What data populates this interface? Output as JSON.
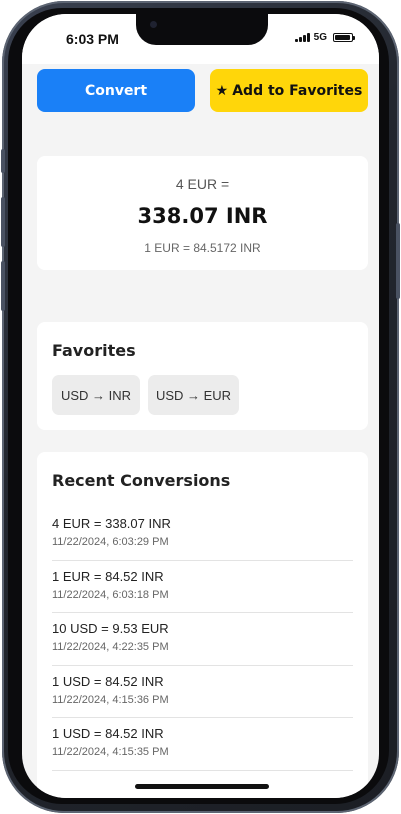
{
  "status_bar": {
    "time": "6:03 PM",
    "network": "5G"
  },
  "actions": {
    "convert_label": "Convert",
    "favorite_icon": "★",
    "favorite_label": "Add to Favorites"
  },
  "result": {
    "input": "4 EUR =",
    "output": "338.07 INR",
    "rate": "1 EUR = 84.5172 INR"
  },
  "favorites": {
    "title": "Favorites",
    "items": [
      {
        "label": "USD → INR"
      },
      {
        "label": "USD → EUR"
      }
    ]
  },
  "recent": {
    "title": "Recent Conversions",
    "items": [
      {
        "conversion": "4 EUR = 338.07 INR",
        "timestamp": "11/22/2024, 6:03:29 PM"
      },
      {
        "conversion": "1 EUR = 84.52 INR",
        "timestamp": "11/22/2024, 6:03:18 PM"
      },
      {
        "conversion": "10 USD = 9.53 EUR",
        "timestamp": "11/22/2024, 4:22:35 PM"
      },
      {
        "conversion": "1 USD = 84.52 INR",
        "timestamp": "11/22/2024, 4:15:36 PM"
      },
      {
        "conversion": "1 USD = 84.52 INR",
        "timestamp": "11/22/2024, 4:15:35 PM"
      }
    ]
  },
  "colors": {
    "primary": "#1a80f7",
    "favorite": "#ffd60a",
    "background": "#f4f4f4",
    "card": "#ffffff"
  }
}
